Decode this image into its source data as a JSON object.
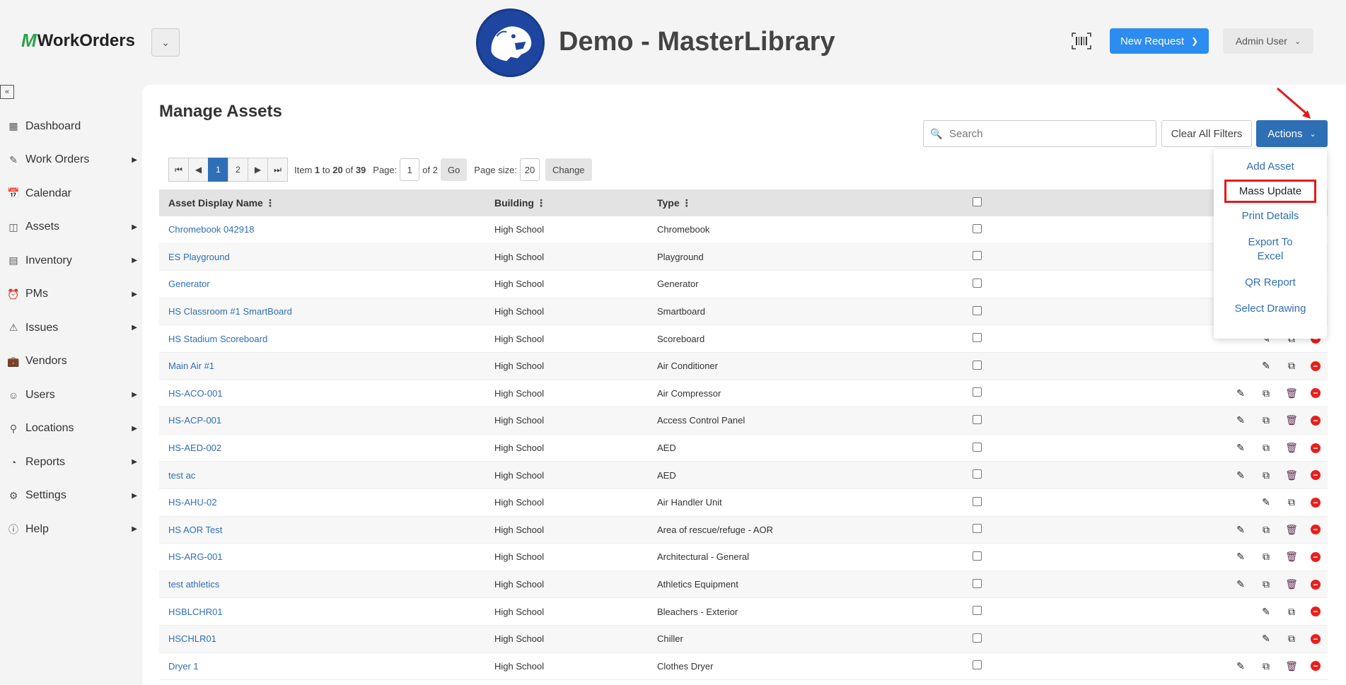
{
  "header": {
    "logo_mark": "M",
    "logo_text": "WorkOrders",
    "site_title": "Demo - MasterLibrary",
    "new_request_label": "New Request",
    "user_label": "Admin User"
  },
  "sidebar": {
    "items": [
      {
        "label": "Dashboard",
        "icon": "dashboard-icon",
        "has_arrow": false
      },
      {
        "label": "Work Orders",
        "icon": "work-orders-icon",
        "has_arrow": true
      },
      {
        "label": "Calendar",
        "icon": "calendar-icon",
        "has_arrow": false
      },
      {
        "label": "Assets",
        "icon": "assets-icon",
        "has_arrow": true
      },
      {
        "label": "Inventory",
        "icon": "inventory-icon",
        "has_arrow": true
      },
      {
        "label": "PMs",
        "icon": "pms-icon",
        "has_arrow": true
      },
      {
        "label": "Issues",
        "icon": "warning-icon",
        "has_arrow": true
      },
      {
        "label": "Vendors",
        "icon": "briefcase-icon",
        "has_arrow": false
      },
      {
        "label": "Users",
        "icon": "users-icon",
        "has_arrow": true
      },
      {
        "label": "Locations",
        "icon": "location-pin-icon",
        "has_arrow": true
      },
      {
        "label": "Reports",
        "icon": "pie-chart-icon",
        "has_arrow": true
      },
      {
        "label": "Settings",
        "icon": "gear-icon",
        "has_arrow": true
      },
      {
        "label": "Help",
        "icon": "help-icon",
        "has_arrow": true
      }
    ]
  },
  "main": {
    "title": "Manage Assets",
    "search_placeholder": "Search",
    "clear_filters_label": "Clear All Filters",
    "actions_label": "Actions"
  },
  "pager": {
    "pages": [
      "1",
      "2"
    ],
    "item_prefix": "Item",
    "item_from": "1",
    "item_to_word": "to",
    "item_to": "20",
    "item_of_word": "of",
    "item_total": "39",
    "page_label": "Page:",
    "page_value": "1",
    "of_pages": "of 2",
    "go_label": "Go",
    "page_size_label": "Page size:",
    "page_size_value": "20",
    "change_label": "Change"
  },
  "table": {
    "headers": [
      "Asset Display Name",
      "Building",
      "Type"
    ],
    "rows": [
      {
        "name": "Chromebook 042918",
        "building": "High School",
        "type": "Chromebook",
        "actions": []
      },
      {
        "name": "ES Playground",
        "building": "High School",
        "type": "Playground",
        "actions": []
      },
      {
        "name": "Generator",
        "building": "High School",
        "type": "Generator",
        "actions": []
      },
      {
        "name": "HS Classroom #1 SmartBoard",
        "building": "High School",
        "type": "Smartboard",
        "actions": []
      },
      {
        "name": "HS Stadium Scoreboard",
        "building": "High School",
        "type": "Scoreboard",
        "actions": [
          "edit",
          "copy",
          "remove"
        ]
      },
      {
        "name": "Main Air #1",
        "building": "High School",
        "type": "Air Conditioner",
        "actions": [
          "edit",
          "copy",
          "remove"
        ]
      },
      {
        "name": "HS-ACO-001",
        "building": "High School",
        "type": "Air Compressor",
        "actions": [
          "edit",
          "copy",
          "delete",
          "remove"
        ]
      },
      {
        "name": "HS-ACP-001",
        "building": "High School",
        "type": "Access Control Panel",
        "actions": [
          "edit",
          "copy",
          "delete",
          "remove"
        ]
      },
      {
        "name": "HS-AED-002",
        "building": "High School",
        "type": "AED",
        "actions": [
          "edit",
          "copy",
          "delete",
          "remove"
        ]
      },
      {
        "name": "test ac",
        "building": "High School",
        "type": "AED",
        "actions": [
          "edit",
          "copy",
          "delete",
          "remove"
        ]
      },
      {
        "name": "HS-AHU-02",
        "building": "High School",
        "type": "Air Handler Unit",
        "actions": [
          "edit",
          "copy",
          "remove"
        ]
      },
      {
        "name": "HS AOR Test",
        "building": "High School",
        "type": "Area of rescue/refuge - AOR",
        "actions": [
          "edit",
          "copy",
          "delete",
          "remove"
        ]
      },
      {
        "name": "HS-ARG-001",
        "building": "High School",
        "type": "Architectural - General",
        "actions": [
          "edit",
          "copy",
          "delete",
          "remove"
        ]
      },
      {
        "name": "test athletics",
        "building": "High School",
        "type": "Athletics Equipment",
        "actions": [
          "edit",
          "copy",
          "delete",
          "remove"
        ]
      },
      {
        "name": "HSBLCHR01",
        "building": "High School",
        "type": "Bleachers - Exterior",
        "actions": [
          "edit",
          "copy",
          "remove"
        ]
      },
      {
        "name": "HSCHLR01",
        "building": "High School",
        "type": "Chiller",
        "actions": [
          "edit",
          "copy",
          "remove"
        ]
      },
      {
        "name": "Dryer 1",
        "building": "High School",
        "type": "Clothes Dryer",
        "actions": [
          "edit",
          "copy",
          "delete",
          "remove"
        ]
      }
    ]
  },
  "actions_menu": {
    "items": [
      "Add Asset",
      "Mass Update",
      "Print Details",
      "Export To Excel",
      "QR Report",
      "Select Drawing"
    ],
    "highlighted": "Mass Update"
  },
  "colors": {
    "accent": "#2f6fb5",
    "new_request": "#2d8cf0",
    "highlight": "#e11b1b",
    "logo_green": "#2aa24a"
  }
}
